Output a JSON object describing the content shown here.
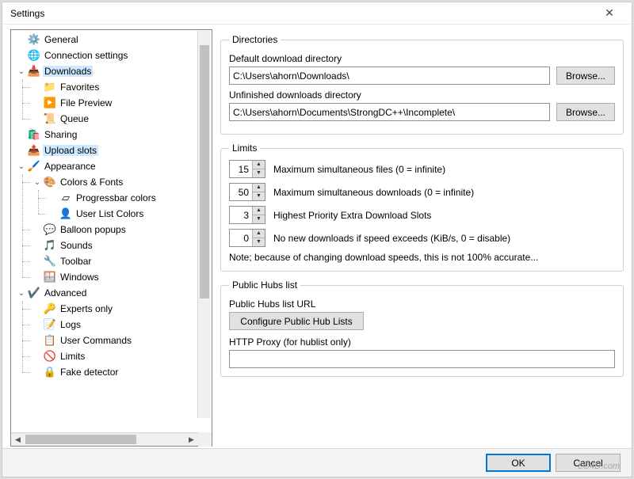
{
  "window": {
    "title": "Settings"
  },
  "tree": [
    {
      "label": "General",
      "icon": "⚙️"
    },
    {
      "label": "Connection settings",
      "icon": "🌐"
    },
    {
      "label": "Downloads",
      "icon": "📥",
      "expanded": true,
      "selected": true,
      "children": [
        {
          "label": "Favorites",
          "icon": "📁"
        },
        {
          "label": "File Preview",
          "icon": "▶️"
        },
        {
          "label": "Queue",
          "icon": "📜"
        }
      ]
    },
    {
      "label": "Sharing",
      "icon": "🛍️"
    },
    {
      "label": "Upload slots",
      "icon": "📤",
      "selected": true
    },
    {
      "label": "Appearance",
      "icon": "🖌️",
      "expanded": true,
      "children": [
        {
          "label": "Colors & Fonts",
          "icon": "🎨",
          "expanded": true,
          "children": [
            {
              "label": "Progressbar colors",
              "icon": "▱"
            },
            {
              "label": "User List Colors",
              "icon": "👤"
            }
          ]
        },
        {
          "label": "Balloon popups",
          "icon": "💬"
        },
        {
          "label": "Sounds",
          "icon": "🎵"
        },
        {
          "label": "Toolbar",
          "icon": "🔧"
        },
        {
          "label": "Windows",
          "icon": "🪟"
        }
      ]
    },
    {
      "label": "Advanced",
      "icon": "✔️",
      "expanded": true,
      "children": [
        {
          "label": "Experts only",
          "icon": "🔑"
        },
        {
          "label": "Logs",
          "icon": "📝"
        },
        {
          "label": "User Commands",
          "icon": "📋"
        },
        {
          "label": "Limits",
          "icon": "🚫"
        },
        {
          "label": "Fake detector",
          "icon": "🔒",
          "expanded": true
        }
      ]
    }
  ],
  "directories": {
    "legend": "Directories",
    "default_label": "Default download directory",
    "default_value": "C:\\Users\\ahorn\\Downloads\\",
    "unfinished_label": "Unfinished downloads directory",
    "unfinished_value": "C:\\Users\\ahorn\\Documents\\StrongDC++\\Incomplete\\",
    "browse_label": "Browse..."
  },
  "limits": {
    "legend": "Limits",
    "rows": [
      {
        "value": "15",
        "label": "Maximum simultaneous files (0 = infinite)"
      },
      {
        "value": "50",
        "label": "Maximum simultaneous downloads (0 = infinite)"
      },
      {
        "value": "3",
        "label": "Highest Priority Extra Download Slots"
      },
      {
        "value": "0",
        "label": "No new downloads if speed exceeds (KiB/s, 0 = disable)"
      }
    ],
    "note": "Note; because of changing download speeds, this is not 100% accurate..."
  },
  "hubs": {
    "legend": "Public Hubs list",
    "url_label": "Public Hubs list URL",
    "configure_label": "Configure Public Hub Lists",
    "proxy_label": "HTTP Proxy (for hublist only)",
    "proxy_value": ""
  },
  "footer": {
    "ok": "OK",
    "cancel": "Cancel"
  },
  "watermark": "LO4D.com"
}
